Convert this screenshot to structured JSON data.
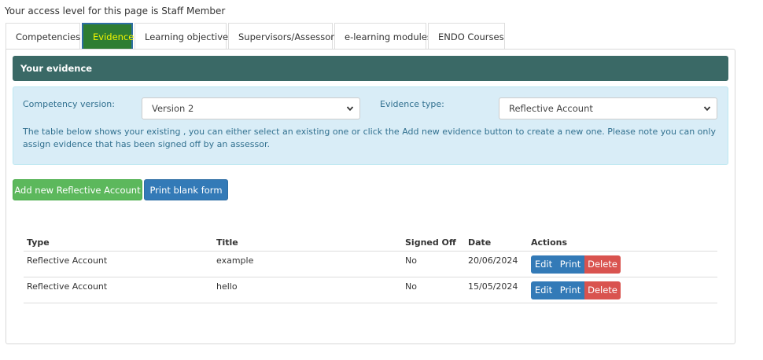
{
  "access_line": "Your access level for this page is Staff Member",
  "tabs": [
    {
      "label": "Competencies",
      "active": false
    },
    {
      "label": "Evidence",
      "active": true
    },
    {
      "label": "Learning objectives",
      "active": false
    },
    {
      "label": "Supervisors/Assessors",
      "active": false
    },
    {
      "label": "e-learning modules",
      "active": false
    },
    {
      "label": "ENDO Courses",
      "active": false
    }
  ],
  "panel": {
    "heading": "Your evidence",
    "competency_version_label": "Competency version:",
    "competency_version_value": "Version 2",
    "evidence_type_label": "Evidence type:",
    "evidence_type_value": "Reflective Account",
    "info_text": "The table below shows your existing , you can either select an existing one or click the Add new evidence button to create a new one. Please note you can only assign evidence that has been signed off by an assessor."
  },
  "buttons": {
    "add_new": "Add new Reflective Account",
    "print_blank": "Print blank form"
  },
  "table": {
    "headers": [
      "Type",
      "Title",
      "Signed Off",
      "Date",
      "Actions"
    ],
    "rows": [
      {
        "type": "Reflective Account",
        "title": "example",
        "signed_off": "No",
        "date": "20/06/2024"
      },
      {
        "type": "Reflective Account",
        "title": "hello",
        "signed_off": "No",
        "date": "15/05/2024"
      }
    ],
    "action_labels": {
      "edit": "Edit",
      "print": "Print",
      "delete": "Delete"
    }
  },
  "colors": {
    "heading_bg": "#3a6966",
    "active_tab_bg": "#2e7d32",
    "active_tab_text": "#f0f400",
    "info_bg": "#d9edf7",
    "btn_green": "#5cb85c",
    "btn_blue": "#337ab7",
    "btn_red": "#d9534f"
  },
  "icons": {
    "select_chevron": "chevron-down-icon"
  }
}
